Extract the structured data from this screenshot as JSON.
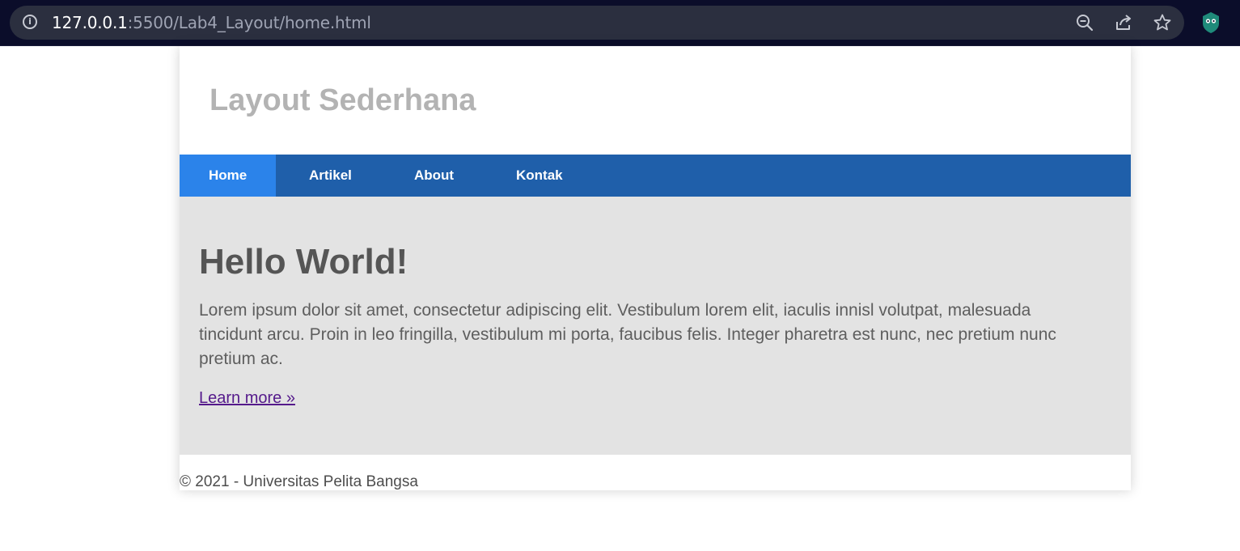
{
  "browser": {
    "url_host": "127.0.0.1",
    "url_rest": ":5500/Lab4_Layout/home.html",
    "icons": [
      "info-icon",
      "zoom-out-icon",
      "share-icon",
      "bookmark-star-icon",
      "extension-icon"
    ]
  },
  "header": {
    "title": "Layout Sederhana"
  },
  "nav": {
    "items": [
      {
        "label": "Home"
      },
      {
        "label": "Artikel"
      },
      {
        "label": "About"
      },
      {
        "label": "Kontak"
      }
    ]
  },
  "hero": {
    "heading": "Hello World!",
    "body": "Lorem ipsum dolor sit amet, consectetur adipiscing elit. Vestibulum lorem elit, iaculis innisl volutpat, malesuada tincidunt arcu. Proin in leo fringilla, vestibulum mi porta, faucibus felis. Integer pharetra est nunc, nec pretium nunc pretium ac.",
    "link": "Learn more »"
  },
  "footer": {
    "text": "© 2021 - Universitas Pelita Bangsa"
  },
  "colors": {
    "nav_bg": "#1f5faa",
    "nav_active": "#2b83ea",
    "hero_bg": "#e3e3e3",
    "browser_bg": "#0b0d2a"
  }
}
